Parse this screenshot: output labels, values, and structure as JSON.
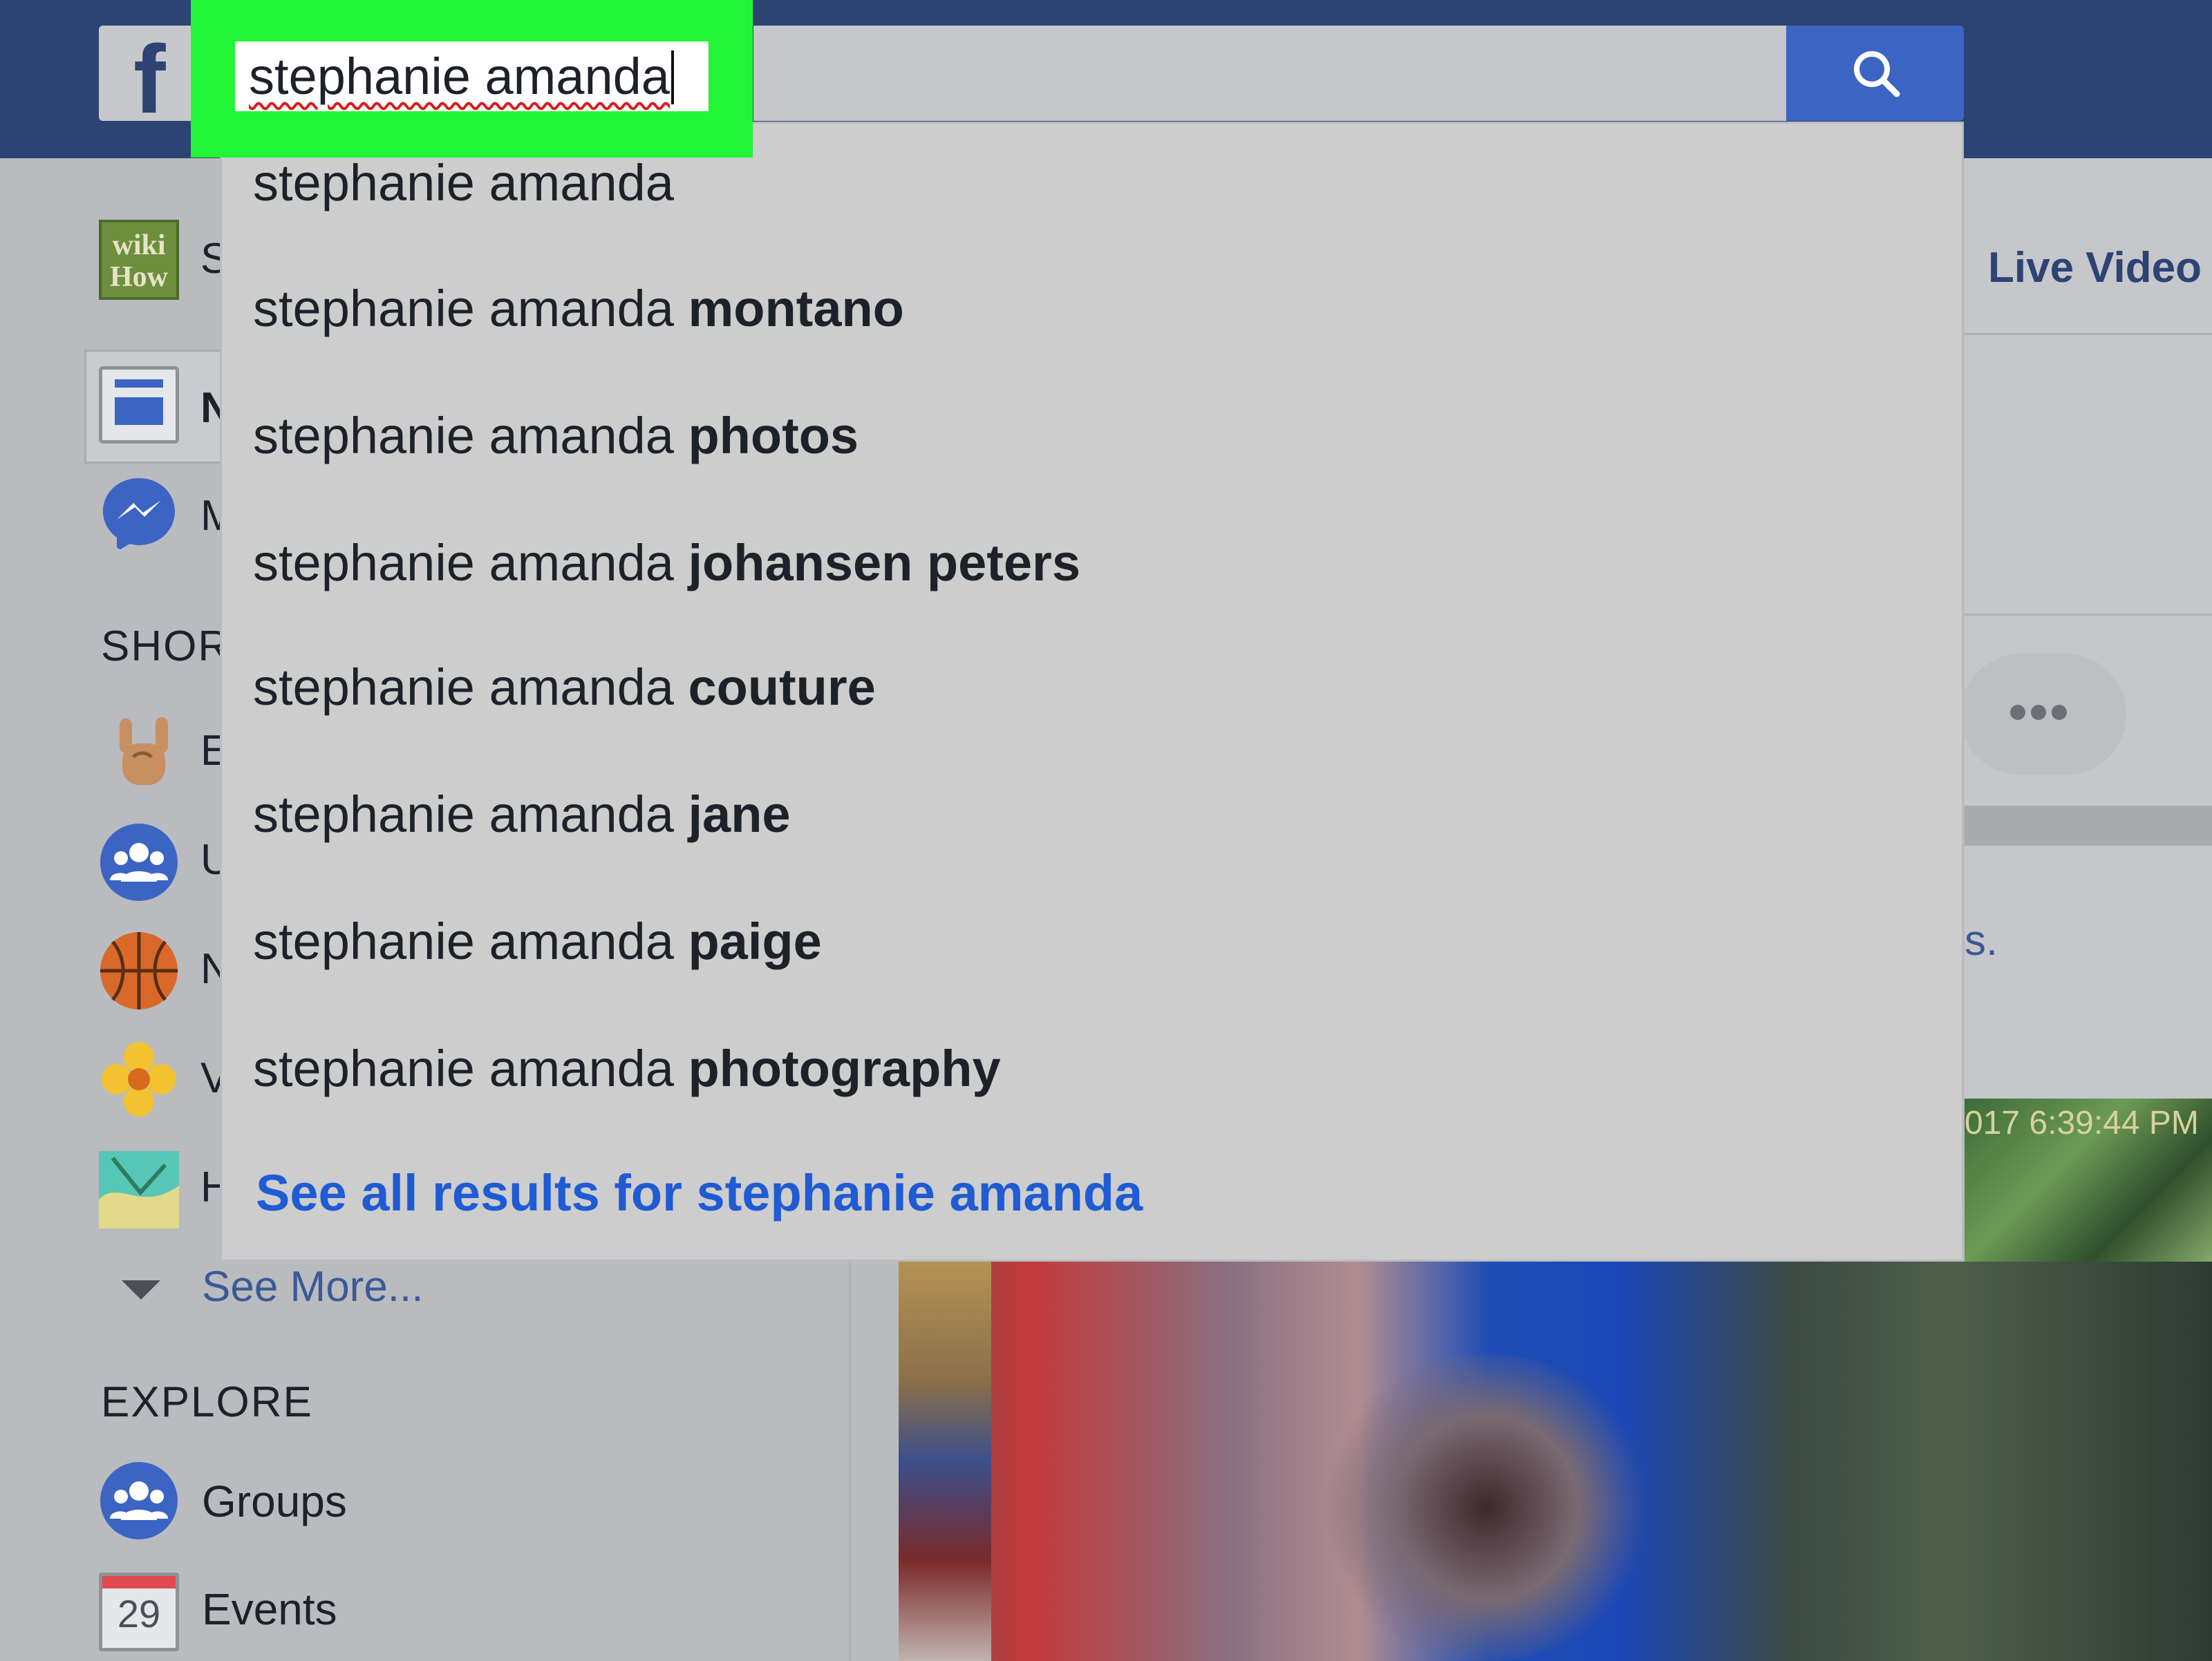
{
  "search": {
    "query": "stephanie amanda",
    "button_icon": "search-icon"
  },
  "logo": {
    "glyph": "f",
    "icon": "facebook-logo"
  },
  "suggestions": [
    {
      "prefix": "stephanie amanda",
      "completion": ""
    },
    {
      "prefix": "stephanie amanda ",
      "completion": "montano"
    },
    {
      "prefix": "stephanie amanda ",
      "completion": "photos"
    },
    {
      "prefix": "stephanie amanda ",
      "completion": "johansen peters"
    },
    {
      "prefix": "stephanie amanda ",
      "completion": "couture"
    },
    {
      "prefix": "stephanie amanda ",
      "completion": "jane"
    },
    {
      "prefix": "stephanie amanda ",
      "completion": "paige"
    },
    {
      "prefix": "stephanie amanda ",
      "completion": "photography"
    }
  ],
  "see_all": "See all results for stephanie amanda",
  "sidebar": {
    "profile": {
      "icon_text": "wiki How",
      "partial": "S"
    },
    "news_feed_partial": "N",
    "messenger_partial": "M",
    "shortcuts_title": "SHOR",
    "shortcuts": [
      {
        "icon": "rock-hand-icon",
        "partial": "E"
      },
      {
        "icon": "group-icon",
        "partial": "U"
      },
      {
        "icon": "basketball-icon",
        "partial": "N"
      },
      {
        "icon": "flower-icon",
        "partial": "V"
      },
      {
        "icon": "map-icon",
        "partial": "H"
      }
    ],
    "see_more": "See More...",
    "explore_title": "EXPLORE",
    "explore": [
      {
        "icon": "group-icon",
        "label": "Groups"
      },
      {
        "icon": "calendar-icon",
        "label": "Events",
        "day": "29"
      }
    ]
  },
  "main": {
    "live_video": "Live Video",
    "partial_link": "s.",
    "photo_timestamp": "017 6:39:44 PM"
  },
  "colors": {
    "nav_blue": "#2d4373",
    "search_button": "#3c64c3",
    "highlight_green": "#22f535",
    "link_blue": "#1f5bd3"
  }
}
